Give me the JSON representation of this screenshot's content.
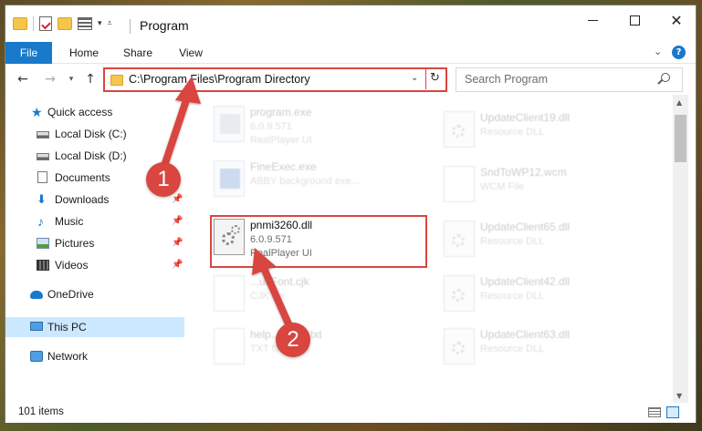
{
  "window": {
    "title": "Program",
    "minimize_label": "",
    "maximize_label": "",
    "close_label": "✕"
  },
  "ribbon": {
    "tabs": [
      "File",
      "Home",
      "Share",
      "View"
    ],
    "help": "?"
  },
  "nav": {
    "address": "C:\\Program Files\\Program Directory",
    "search_placeholder": "Search Program"
  },
  "sidebar": {
    "items": [
      {
        "label": "Quick access",
        "icon": "star-icon"
      },
      {
        "label": "Local Disk (C:)",
        "icon": "disk-icon"
      },
      {
        "label": "Local Disk (D:)",
        "icon": "disk-icon"
      },
      {
        "label": "Documents",
        "icon": "document-icon"
      },
      {
        "label": "Downloads",
        "icon": "download-icon"
      },
      {
        "label": "Music",
        "icon": "music-icon"
      },
      {
        "label": "Pictures",
        "icon": "pictures-icon"
      },
      {
        "label": "Videos",
        "icon": "video-icon"
      },
      {
        "label": "OneDrive",
        "icon": "cloud-icon"
      },
      {
        "label": "This PC",
        "icon": "computer-icon"
      },
      {
        "label": "Network",
        "icon": "network-icon"
      }
    ]
  },
  "files": {
    "left": [
      {
        "name": "program.exe",
        "version": "6.0.9.571",
        "desc": "RealPlayer UI"
      },
      {
        "name": "FineExec.exe",
        "version": "",
        "desc": "ABBY background exe..."
      },
      {
        "name": "pnmi3260.dll",
        "version": "6.0.9.571",
        "desc": "RealPlayer UI"
      },
      {
        "name": "...ultFont.cjk",
        "version": "",
        "desc": "CJK file"
      },
      {
        "name": "help...eader.txt",
        "version": "",
        "desc": "TXT file"
      }
    ],
    "right": [
      {
        "name": "UpdateClient19.dll",
        "version": "",
        "desc": "Resource DLL"
      },
      {
        "name": "SndToWP12.wcm",
        "version": "",
        "desc": "WCM File"
      },
      {
        "name": "UpdateClient65.dll",
        "version": "",
        "desc": "Resource DLL"
      },
      {
        "name": "UpdateClient42.dll",
        "version": "",
        "desc": "Resource DLL"
      },
      {
        "name": "UpdateClient63.dll",
        "version": "",
        "desc": "Resource DLL"
      }
    ]
  },
  "status": {
    "item_count": "101 items"
  },
  "callouts": [
    "1",
    "2"
  ],
  "colors": {
    "accent": "#1979ca",
    "highlight": "#d9453f",
    "selected": "#cce8ff"
  }
}
